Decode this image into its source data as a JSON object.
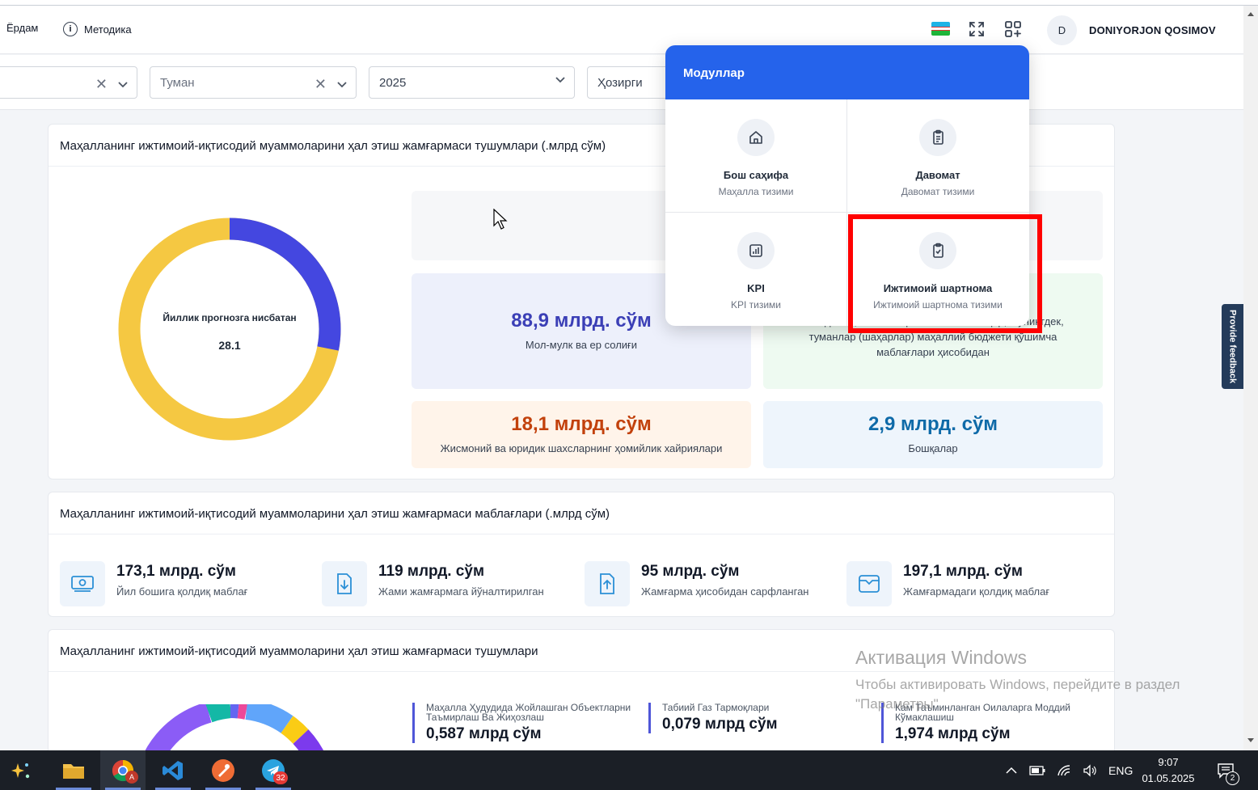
{
  "header": {
    "help_label": "Ёрдам",
    "method_label": "Методика",
    "info_glyph": "i",
    "avatar_initial": "D",
    "username": "DONIYORJON QOSIMOV"
  },
  "filters": {
    "district_placeholder": "Туман",
    "year_value": "2025",
    "period_value": "Ҳозирги"
  },
  "card1": {
    "title": "Маҳалланинг ижтимоий-иқтисодий муаммоларини ҳал этиш жамғармаси тушумлари (.млрд сўм)",
    "donut_label": "Йиллик прогнозга нисбатан",
    "donut_value": "28.1",
    "stats": [
      {
        "value": "88,9 млрд. сўм",
        "label": "Мол-мулк ва ер солиғи",
        "color": "#3b3fb6"
      },
      {
        "value": "",
        "label": "...бюджети, вилоятлар ва Тошкент шаҳар, шунингдек, туманлар (шаҳарлар) маҳаллий бюджети қўшимча маблағлари ҳисобидан",
        "color": "#15803d"
      },
      {
        "value": "18,1 млрд. сўм",
        "label": "Жисмоний ва юридик шахсларнинг ҳомийлик хайриялари",
        "color": "#c2410c"
      },
      {
        "value": "2,9 млрд. сўм",
        "label": "Бошқалар",
        "color": "#0e6aa8"
      }
    ]
  },
  "card2": {
    "title": "Маҳалланинг ижтимоий-иқтисодий муаммоларини ҳал этиш жамғармаси маблағлари (.млрд сўм)",
    "funds": [
      {
        "value": "173,1 млрд. сўм",
        "label": "Йил бошига қолдиқ маблағ",
        "icon": "money-icon"
      },
      {
        "value": "119 млрд. сўм",
        "label": "Жами жамғармага йўналтирилган",
        "icon": "download-doc-icon"
      },
      {
        "value": "95 млрд. сўм",
        "label": "Жамғарма ҳисобидан сарфланган",
        "icon": "upload-doc-icon"
      },
      {
        "value": "197,1 млрд. сўм",
        "label": "Жамғармадаги қолдиқ маблағ",
        "icon": "wallet-icon"
      }
    ]
  },
  "card3": {
    "title": "Маҳалланинг ижтимоий-иқтисодий муаммоларини ҳал этиш жамғармаси тушумлари",
    "items": [
      {
        "title": "Маҳалла Ҳудудида Жойлашган Объектларни Таъмирлаш Ва Жиҳозлаш",
        "value": "0,587 млрд сўм"
      },
      {
        "title": "Табиий Газ Тармоқлари",
        "value": "0,079 млрд сўм"
      },
      {
        "title": "Кам Таъминланган Оилаларга Моддий Кўмаклашиш",
        "value": "1,974 млрд сўм"
      }
    ]
  },
  "modules": {
    "title": "Модуллар",
    "items": [
      {
        "name": "Бош саҳифа",
        "desc": "Маҳалла тизими",
        "icon": "home-icon"
      },
      {
        "name": "Давомат",
        "desc": "Давомат тизими",
        "icon": "clipboard-icon"
      },
      {
        "name": "KPI",
        "desc": "KPI тизими",
        "icon": "chart-icon"
      },
      {
        "name": "Ижтимоий шартнома",
        "desc": "Ижтимоий шартнома тизими",
        "icon": "clipboard-check-icon"
      }
    ]
  },
  "feedback_label": "Provide feedback",
  "activation": {
    "title": "Активация Windows",
    "text": "Чтобы активировать Windows, перейдите в раздел \"Параметры\"."
  },
  "taskbar": {
    "language": "ENG",
    "time": "9:07",
    "date": "01.05.2025",
    "telegram_badge": "32",
    "notifications_badge": "2",
    "chrome_badge": "A"
  },
  "colors": {
    "accent": "#2563eb",
    "donut_yellow": "#f5c842",
    "donut_blue": "#4447e0",
    "highlight": "#ff0000"
  }
}
